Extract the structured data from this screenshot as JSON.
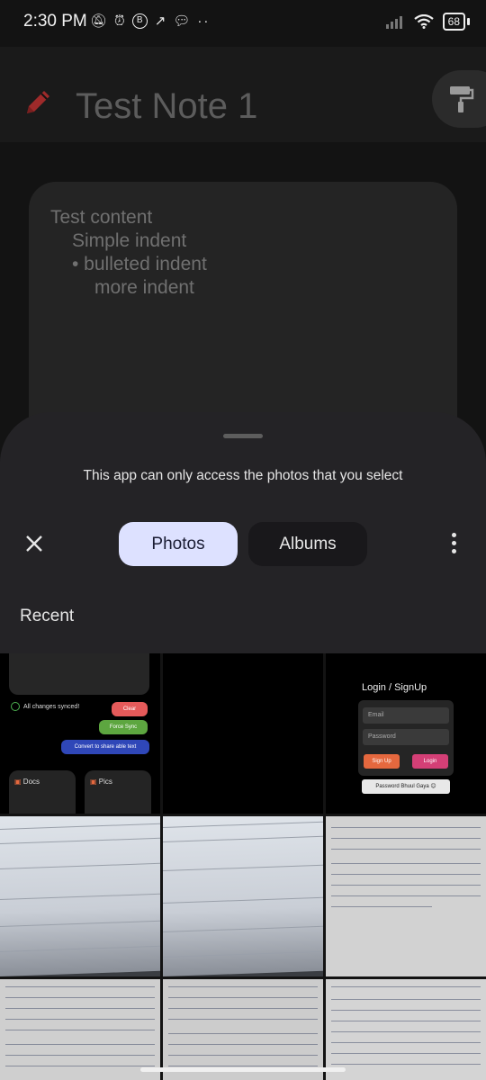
{
  "status_bar": {
    "time": "2:30 PM",
    "battery": "68",
    "icons_left": [
      "mute-icon",
      "alarm-icon",
      "b-icon",
      "missed-call-icon",
      "chat-icon",
      "more-dots-icon"
    ],
    "icons_right": [
      "signal-icon",
      "wifi-icon",
      "battery-icon"
    ]
  },
  "note": {
    "title": "Test Note 1",
    "content_lines": [
      "Test content",
      "Simple indent",
      "• bulleted indent",
      "more indent"
    ]
  },
  "sheet": {
    "message": "This app can only access the photos that you select",
    "tabs": [
      "Photos",
      "Albums"
    ],
    "selected_tab": "Photos",
    "section_title": "Recent"
  },
  "thumbs": {
    "app": {
      "sync_text": "All changes synced!",
      "clear": "Clear",
      "force_sync": "Force Sync",
      "convert": "Convert to share able text",
      "docs": "Docs",
      "pics": "Pics"
    },
    "login": {
      "title": "Login / SignUp",
      "email": "Email",
      "password": "Password",
      "signup": "Sign Up",
      "login": "Login",
      "forgot": "Password Bhuul Gaya 😊"
    }
  },
  "colors": {
    "accent_pencil": "#9e2a2a",
    "tab_selected_bg": "#dde1ff",
    "signup_btn": "#e5683e",
    "login_btn": "#d43f76"
  }
}
